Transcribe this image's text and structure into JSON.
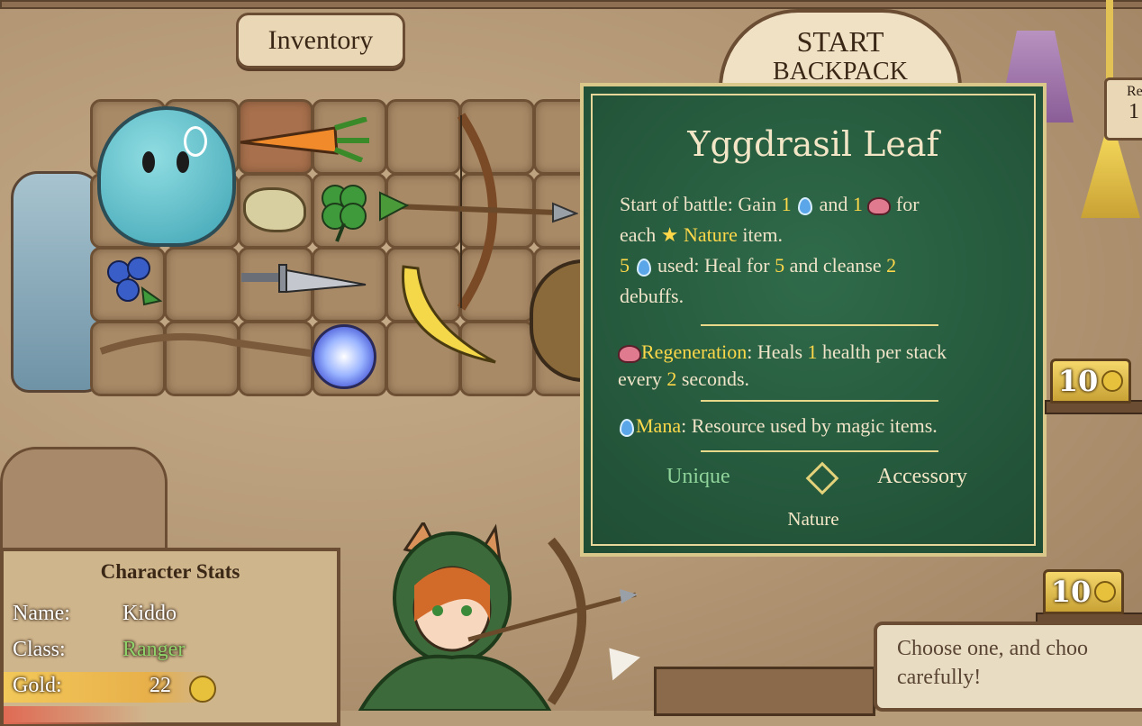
{
  "header": {
    "inventory_label": "Inventory",
    "start_button_line1": "START",
    "start_button_line2": "BACKPACK"
  },
  "inventory": {
    "items": [
      {
        "name": "slime",
        "icon": "slime-icon"
      },
      {
        "name": "carrot",
        "icon": "carrot-icon"
      },
      {
        "name": "stone-chunk",
        "icon": "stone-icon"
      },
      {
        "name": "clover",
        "icon": "clover-icon"
      },
      {
        "name": "leaf-arrow",
        "icon": "arrow-icon"
      },
      {
        "name": "bow",
        "icon": "bow-icon"
      },
      {
        "name": "blueberries",
        "icon": "blueberries-icon"
      },
      {
        "name": "dagger",
        "icon": "dagger-icon"
      },
      {
        "name": "banana",
        "icon": "banana-icon"
      },
      {
        "name": "magic-orb-whip",
        "icon": "orb-icon"
      },
      {
        "name": "wooden-shield",
        "icon": "shield-icon"
      },
      {
        "name": "backpack",
        "icon": "backpack-icon"
      }
    ]
  },
  "tooltip": {
    "title": "Yggdrasil Leaf",
    "line1_a": "Start of battle: Gain ",
    "line1_n1": "1",
    "line1_b": " and ",
    "line1_n2": "1",
    "line1_c": " for",
    "line2_a": "each ",
    "line2_tag": "Nature",
    "line2_b": " item.",
    "line3_n1": "5",
    "line3_a": " used: Heal for ",
    "line3_n2": "5",
    "line3_b": " and cleanse ",
    "line3_n3": "2",
    "line4": "debuffs.",
    "regen_label": "Regeneration",
    "regen_a": ": Heals ",
    "regen_n1": "1",
    "regen_b": " health per stack",
    "regen_c": "every ",
    "regen_n2": "2",
    "regen_d": " seconds.",
    "mana_label": "Mana",
    "mana_text": ": Resource used by magic items.",
    "rarity": "Unique",
    "type": "Accessory",
    "tag": "Nature",
    "colors": {
      "rarity": "#8fd39a",
      "yellow": "#ffd84a",
      "mana": "#ffd84a"
    }
  },
  "prices": [
    {
      "value": "10"
    },
    {
      "value": "10"
    }
  ],
  "right_edge": {
    "label_partial": "Re",
    "value_partial": "1"
  },
  "stats": {
    "title": "Character Stats",
    "name_label": "Name:",
    "name_value": "Kiddo",
    "class_label": "Class:",
    "class_value": "Ranger",
    "gold_label": "Gold:",
    "gold_value": "22",
    "colors": {
      "class": "#8fd36a"
    }
  },
  "dialog": {
    "line1": "Choose one, and choo",
    "line2": "carefully!"
  }
}
